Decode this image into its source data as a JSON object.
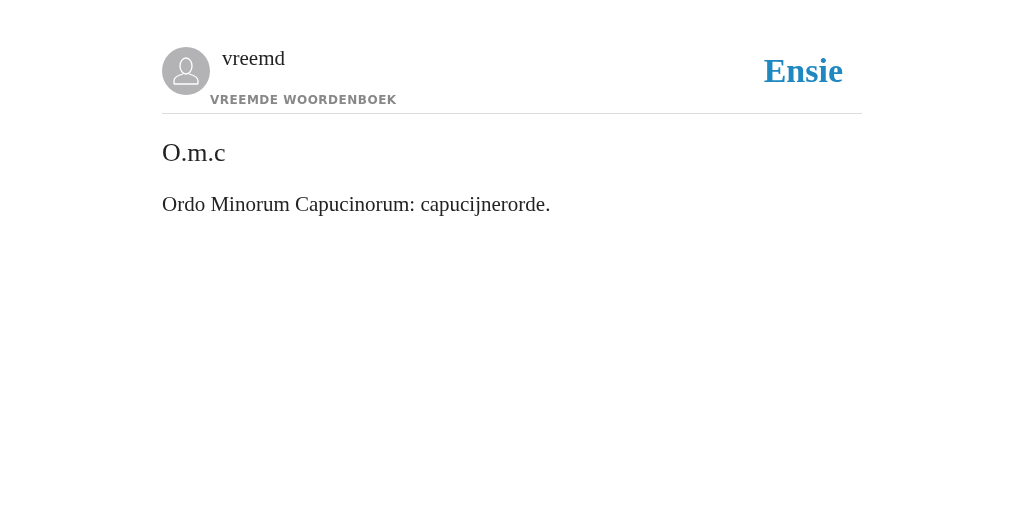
{
  "header": {
    "username": "vreemd",
    "dictionary": "VREEMDE WOORDENBOEK",
    "logo": "Ensie"
  },
  "entry": {
    "term": "O.m.c",
    "definition": "Ordo Minorum Capucinorum: capucijnerorde."
  }
}
